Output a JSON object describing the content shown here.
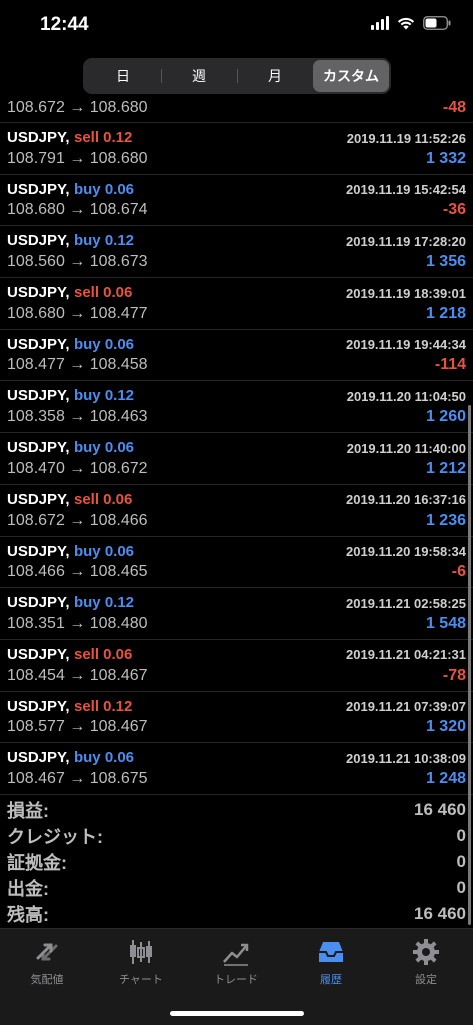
{
  "status": {
    "time": "12:44"
  },
  "segments": [
    {
      "label": "日",
      "active": false
    },
    {
      "label": "週",
      "active": false
    },
    {
      "label": "月",
      "active": false
    },
    {
      "label": "カスタム",
      "active": true
    }
  ],
  "first_row": {
    "prices": "108.672 → 108.680",
    "profit": "-48"
  },
  "trades": [
    {
      "symbol": "USDJPY,",
      "side": "sell 0.12",
      "datetime": "2019.11.19 11:52:26",
      "prices": "108.791 → 108.680",
      "profit": "1 332"
    },
    {
      "symbol": "USDJPY,",
      "side": "buy 0.06",
      "datetime": "2019.11.19 15:42:54",
      "prices": "108.680 → 108.674",
      "profit": "-36"
    },
    {
      "symbol": "USDJPY,",
      "side": "buy 0.12",
      "datetime": "2019.11.19 17:28:20",
      "prices": "108.560 → 108.673",
      "profit": "1 356"
    },
    {
      "symbol": "USDJPY,",
      "side": "sell 0.06",
      "datetime": "2019.11.19 18:39:01",
      "prices": "108.680 → 108.477",
      "profit": "1 218"
    },
    {
      "symbol": "USDJPY,",
      "side": "buy 0.06",
      "datetime": "2019.11.19 19:44:34",
      "prices": "108.477 → 108.458",
      "profit": "-114"
    },
    {
      "symbol": "USDJPY,",
      "side": "buy 0.12",
      "datetime": "2019.11.20 11:04:50",
      "prices": "108.358 → 108.463",
      "profit": "1 260"
    },
    {
      "symbol": "USDJPY,",
      "side": "buy 0.06",
      "datetime": "2019.11.20 11:40:00",
      "prices": "108.470 → 108.672",
      "profit": "1 212"
    },
    {
      "symbol": "USDJPY,",
      "side": "sell 0.06",
      "datetime": "2019.11.20 16:37:16",
      "prices": "108.672 → 108.466",
      "profit": "1 236"
    },
    {
      "symbol": "USDJPY,",
      "side": "buy 0.06",
      "datetime": "2019.11.20 19:58:34",
      "prices": "108.466 → 108.465",
      "profit": "-6"
    },
    {
      "symbol": "USDJPY,",
      "side": "buy 0.12",
      "datetime": "2019.11.21 02:58:25",
      "prices": "108.351 → 108.480",
      "profit": "1 548"
    },
    {
      "symbol": "USDJPY,",
      "side": "sell 0.06",
      "datetime": "2019.11.21 04:21:31",
      "prices": "108.454 → 108.467",
      "profit": "-78"
    },
    {
      "symbol": "USDJPY,",
      "side": "sell 0.12",
      "datetime": "2019.11.21 07:39:07",
      "prices": "108.577 → 108.467",
      "profit": "1 320"
    },
    {
      "symbol": "USDJPY,",
      "side": "buy 0.06",
      "datetime": "2019.11.21 10:38:09",
      "prices": "108.467 → 108.675",
      "profit": "1 248"
    }
  ],
  "summary": [
    {
      "label": "損益:",
      "value": "16 460"
    },
    {
      "label": "クレジット:",
      "value": "0"
    },
    {
      "label": "証拠金:",
      "value": "0"
    },
    {
      "label": "出金:",
      "value": "0"
    },
    {
      "label": "残高:",
      "value": "16 460"
    }
  ],
  "tabs": [
    {
      "label": "気配値",
      "icon": "quotes-arrows-icon",
      "active": false
    },
    {
      "label": "チャート",
      "icon": "candlestick-chart-icon",
      "active": false
    },
    {
      "label": "トレード",
      "icon": "trade-line-icon",
      "active": false
    },
    {
      "label": "履歴",
      "icon": "history-inbox-icon",
      "active": true
    },
    {
      "label": "設定",
      "icon": "gear-icon",
      "active": false
    }
  ],
  "colors": {
    "sell": "#e8533f",
    "buy": "#4a8ef0",
    "accent": "#4a8ef0",
    "background": "#000000"
  }
}
